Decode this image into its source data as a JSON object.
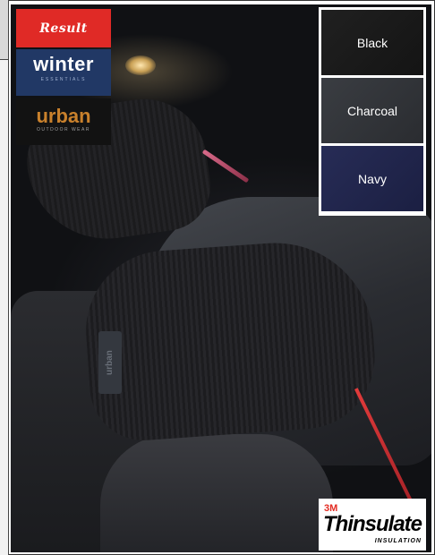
{
  "logos": {
    "result": "Result",
    "winter": "winter",
    "winter_sub": "ESSENTIALS",
    "urban": "urban",
    "urban_sub": "OUTDOOR WEAR"
  },
  "glove_label": "urban",
  "colour_options": [
    {
      "label": "Black",
      "color": "#1a1a1a"
    },
    {
      "label": "Charcoal",
      "color": "#33363b"
    },
    {
      "label": "Navy",
      "color": "#222651"
    }
  ],
  "badge": {
    "brand": "3M",
    "name": "Thinsulate",
    "subtitle": "INSULATION"
  }
}
